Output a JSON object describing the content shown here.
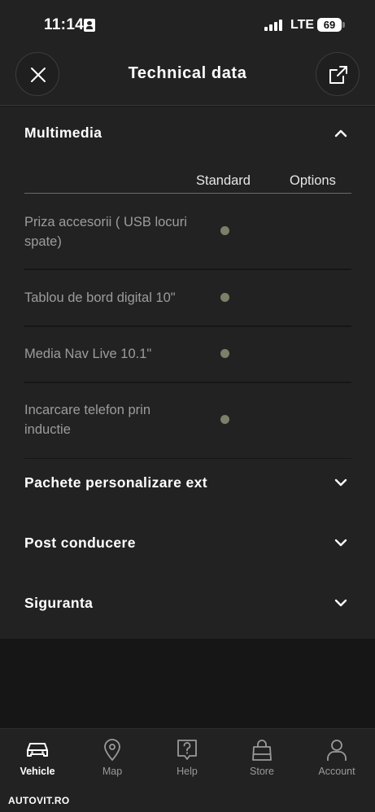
{
  "status_bar": {
    "time": "11:14",
    "network": "LTE",
    "battery": "69"
  },
  "header": {
    "title": "Technical data",
    "close_icon": "close-icon",
    "share_icon": "share-icon"
  },
  "sections": [
    {
      "title": "Multimedia",
      "expanded": true,
      "columns": [
        "Standard",
        "Options"
      ],
      "rows": [
        {
          "label": "Priza accesorii ( USB locuri spate)",
          "standard": true,
          "options": false
        },
        {
          "label": "Tablou de bord digital 10\"",
          "standard": true,
          "options": false
        },
        {
          "label": "Media Nav Live 10.1\"",
          "standard": true,
          "options": false
        },
        {
          "label": "Incarcare telefon prin inductie",
          "standard": true,
          "options": false
        }
      ]
    },
    {
      "title": "Pachete personalizare ext",
      "expanded": false
    },
    {
      "title": "Post conducere",
      "expanded": false
    },
    {
      "title": "Siguranta",
      "expanded": false
    }
  ],
  "tabs": [
    {
      "label": "Vehicle",
      "icon": "car-icon",
      "active": true
    },
    {
      "label": "Map",
      "icon": "map-pin-icon",
      "active": false
    },
    {
      "label": "Help",
      "icon": "help-icon",
      "active": false
    },
    {
      "label": "Store",
      "icon": "shopping-bag-icon",
      "active": false
    },
    {
      "label": "Account",
      "icon": "account-icon",
      "active": false
    }
  ],
  "watermark": "AUTOVIT.RO",
  "colors": {
    "background": "#161616",
    "surface": "#222222",
    "standard_dot": "#7d7f68",
    "muted_text": "#9c9c9c"
  }
}
